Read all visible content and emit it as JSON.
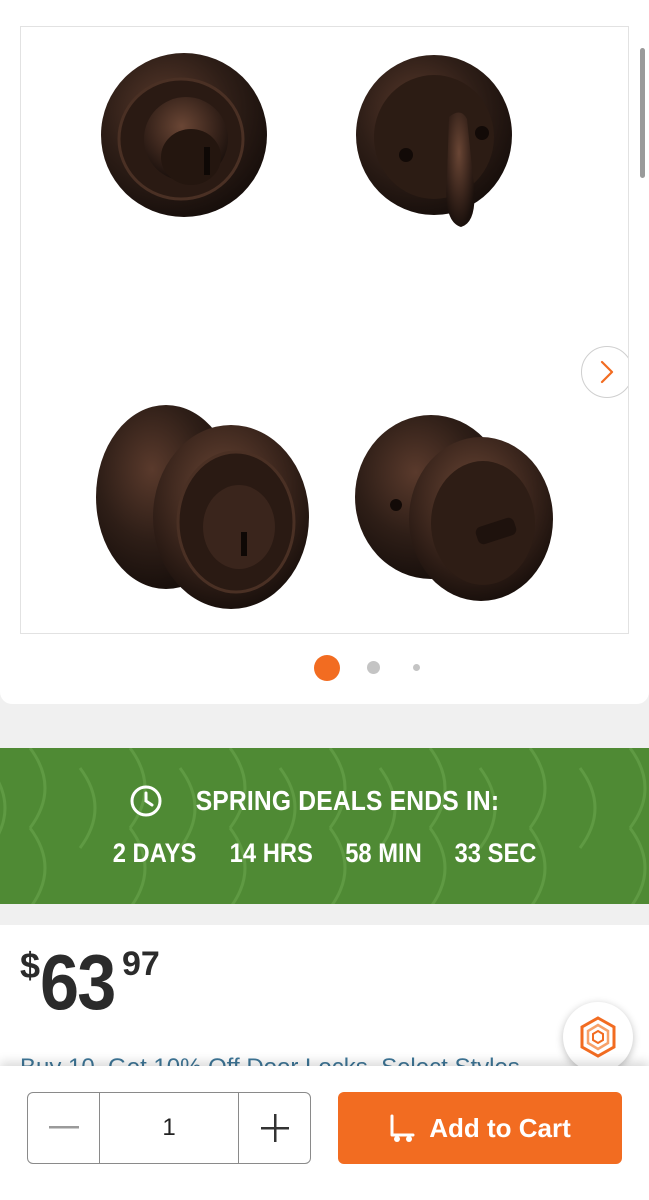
{
  "gallery": {
    "image_alt": "Venetian bronze keyed entry knob and deadbolt combo pack",
    "current_slide": 1,
    "total_dots": 3
  },
  "promo": {
    "title": "SPRING DEALS ENDS IN:",
    "days": "2 DAYS",
    "hours": "14 HRS",
    "minutes": "58 MIN",
    "seconds": "33 SEC",
    "bg_color": "#4f8a34"
  },
  "price": {
    "currency": "$",
    "dollars": "63",
    "cents": "97"
  },
  "bulk_offer": {
    "text": "Buy 10, Get 10% Off Door Locks, Select Styles"
  },
  "cart": {
    "quantity": "1",
    "add_label": "Add to Cart",
    "accent": "#f26c21"
  }
}
